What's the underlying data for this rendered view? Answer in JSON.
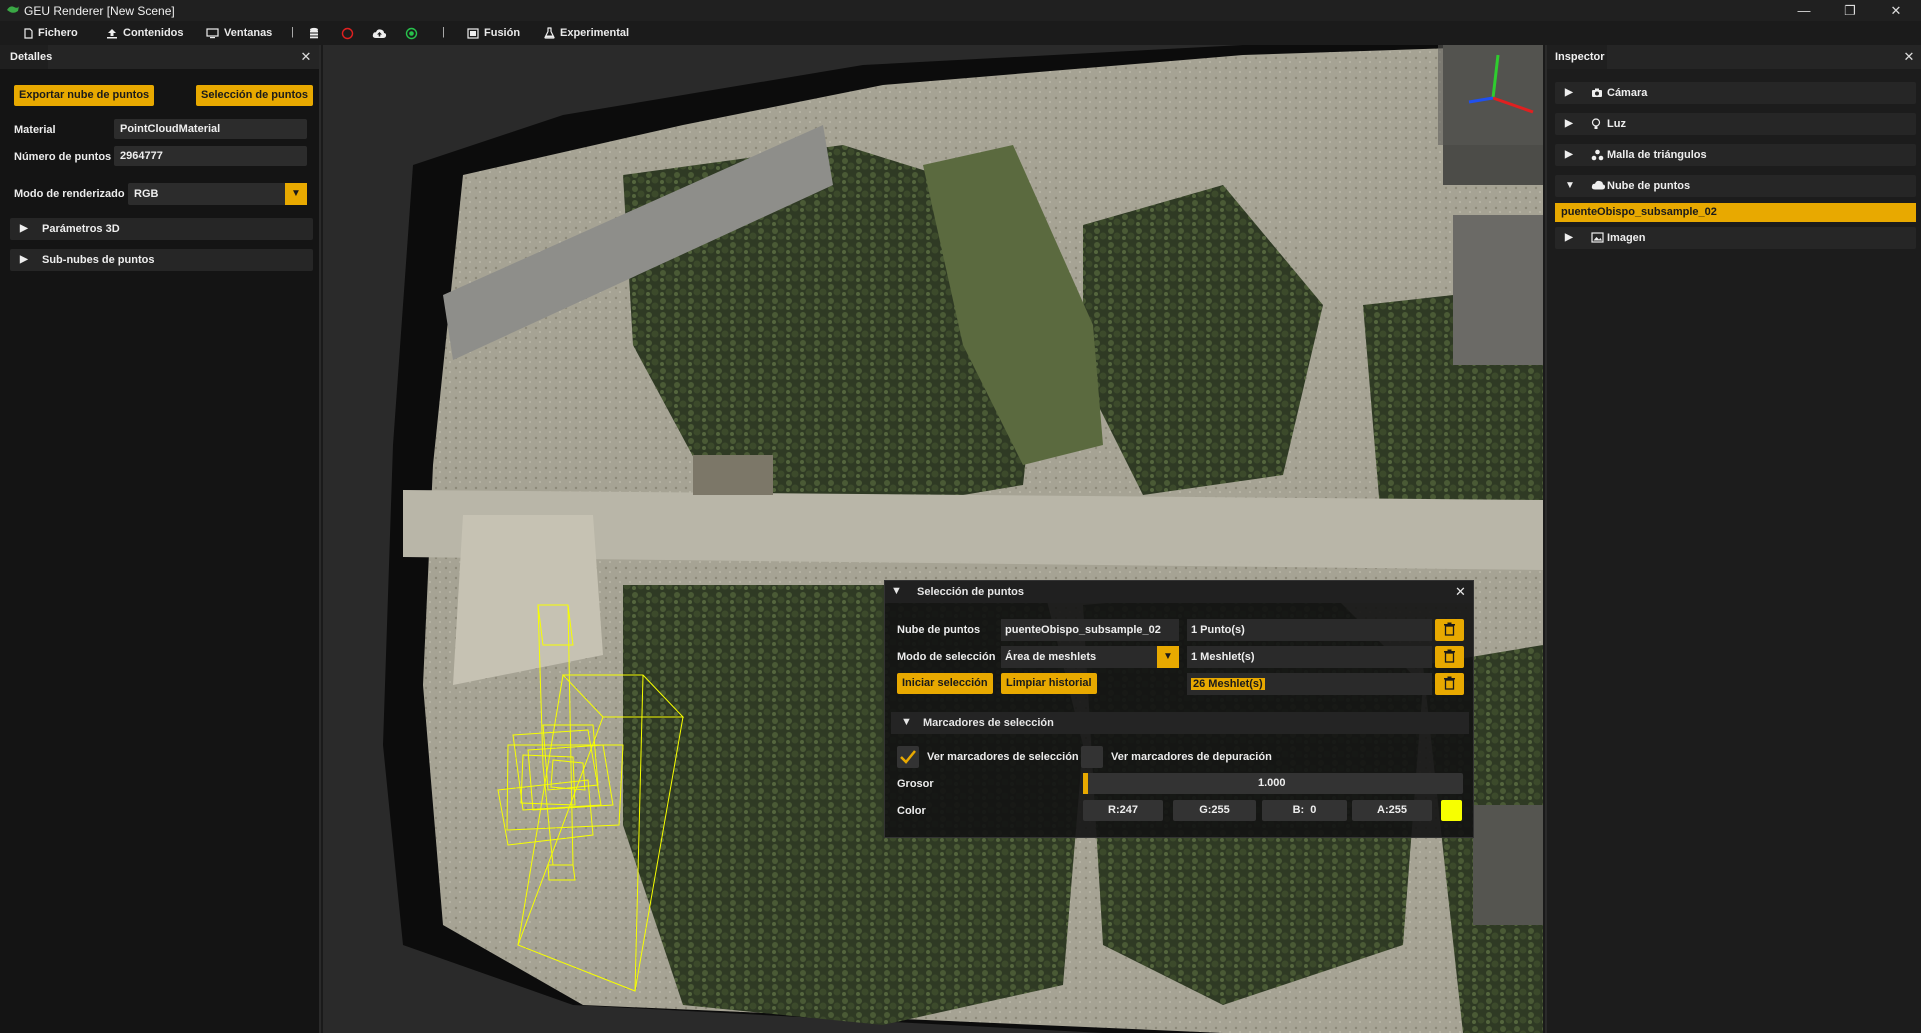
{
  "window": {
    "title": "GEU Renderer [New Scene]",
    "minimize": "—",
    "maximize": "❐",
    "close": "✕"
  },
  "menu": {
    "fichero": "Fichero",
    "contenidos": "Contenidos",
    "ventanas": "Ventanas",
    "sep1": "|",
    "sep2": "|",
    "fusion": "Fusión",
    "experimental": "Experimental"
  },
  "left_panel": {
    "tab": "Detalles",
    "close": "✕",
    "export_button": "Exportar nube de puntos",
    "selection_button": "Selección de puntos",
    "material_label": "Material",
    "material_value": "PointCloudMaterial",
    "num_points_label": "Número de puntos",
    "num_points_value": "2964777",
    "render_mode_label": "Modo de renderizado",
    "render_mode_value": "RGB",
    "params_3d": "Parámetros 3D",
    "subclouds": "Sub-nubes de puntos"
  },
  "inspector": {
    "tab": "Inspector",
    "close": "✕",
    "items": [
      {
        "label": "Cámara",
        "icon": "camera-icon",
        "expanded": false
      },
      {
        "label": "Luz",
        "icon": "lightbulb-icon",
        "expanded": false
      },
      {
        "label": "Malla de triángulos",
        "icon": "mesh-icon",
        "expanded": false
      },
      {
        "label": "Nube de puntos",
        "icon": "cloud-icon",
        "expanded": true
      },
      {
        "label": "Imagen",
        "icon": "image-icon",
        "expanded": false
      }
    ],
    "selected_child": "puenteObispo_subsample_02"
  },
  "selection_panel": {
    "title": "Selección de puntos",
    "close": "✕",
    "cloud_label": "Nube de puntos",
    "cloud_value": "puenteObispo_subsample_02",
    "points_count": "1 Punto(s)",
    "mode_label": "Modo de selección",
    "mode_value": "Área de meshlets",
    "meshlets_count": "1 Meshlet(s)",
    "start_button": "Iniciar selección",
    "clear_button": "Limpiar historial",
    "history_count": "26 Meshlet(s)",
    "markers_section": "Marcadores de selección",
    "show_markers_label": "Ver marcadores de selección",
    "show_markers_checked": true,
    "debug_markers_label": "Ver marcadores de depuración",
    "debug_markers_checked": false,
    "thickness_label": "Grosor",
    "thickness_value": "1.000",
    "color_label": "Color",
    "r": "R:247",
    "g": "G:255",
    "b": "B:  0",
    "a": "A:255",
    "swatch_color": "#f7ff00"
  },
  "colors": {
    "accent": "#e8a900",
    "marker": "#f7ff00"
  }
}
